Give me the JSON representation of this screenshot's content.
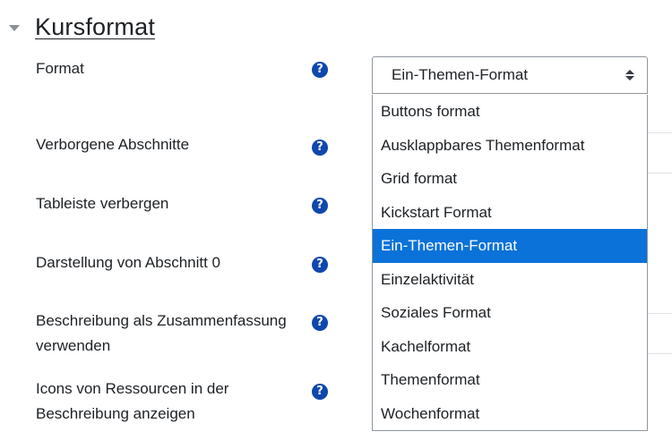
{
  "section": {
    "title": "Kursformat",
    "collapse_icon": "triangle-down"
  },
  "rows": [
    {
      "label": "Format",
      "help_icon": "question-circle"
    },
    {
      "label": "Verborgene Abschnitte",
      "help_icon": "question-circle"
    },
    {
      "label": "Tableiste verbergen",
      "help_icon": "question-circle"
    },
    {
      "label": "Darstellung von Abschnitt 0",
      "help_icon": "question-circle"
    },
    {
      "label": "Beschreibung als Zusammenfassung verwenden",
      "help_icon": "question-circle"
    },
    {
      "label": "Icons von Ressourcen in der Beschreibung anzeigen",
      "help_icon": "question-circle"
    }
  ],
  "help_glyph": "?",
  "format_select": {
    "value": "Ein-Themen-Format",
    "options": [
      "Buttons format",
      "Ausklappbares Themenformat",
      "Grid format",
      "Kickstart Format",
      "Ein-Themen-Format",
      "Einzelaktivität",
      "Soziales Format",
      "Kachelformat",
      "Themenformat",
      "Wochenformat"
    ],
    "selected_option": "Ein-Themen-Format"
  },
  "colors": {
    "help_icon": "#0f47ad",
    "selected_option_bg": "#0a72d8",
    "text": "#1d2125"
  }
}
